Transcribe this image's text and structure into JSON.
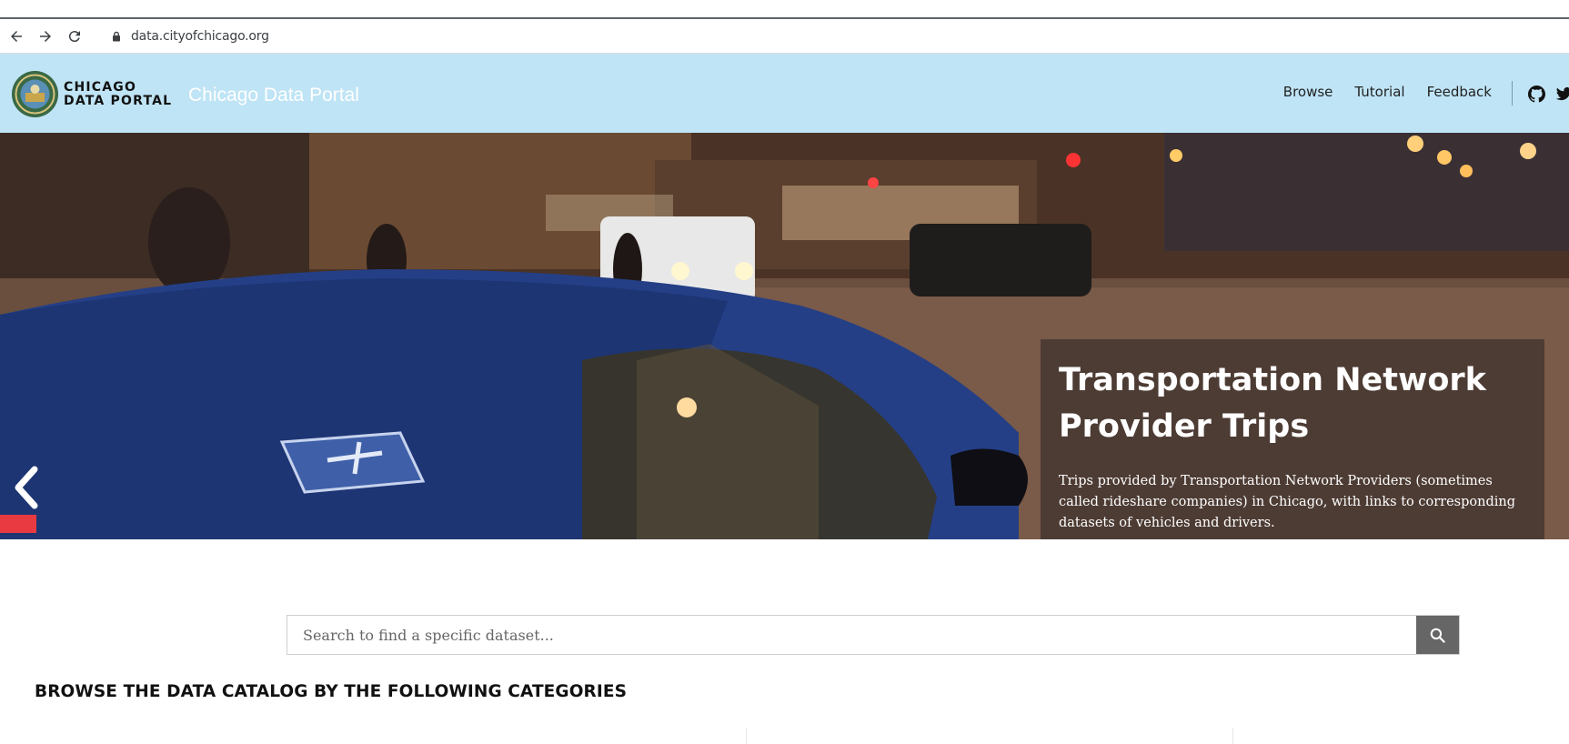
{
  "browser": {
    "url": "data.cityofchicago.org",
    "back_icon": "arrow-left-icon",
    "forward_icon": "arrow-right-icon",
    "reload_icon": "reload-icon",
    "lock_icon": "lock-icon"
  },
  "header": {
    "logo_line1": "CHICAGO",
    "logo_line2": "DATA PORTAL",
    "site_title": "Chicago Data Portal",
    "nav": [
      {
        "label": "Browse"
      },
      {
        "label": "Tutorial"
      },
      {
        "label": "Feedback"
      }
    ],
    "social": [
      "github-icon",
      "twitter-icon"
    ],
    "background_color": "#bfe4f5"
  },
  "hero": {
    "caption_title": "Transportation Network Provider Trips",
    "caption_text": "Trips provided by Transportation Network Providers (sometimes called rideshare companies) in Chicago, with links to corresponding datasets of vehicles and drivers.",
    "prev_icon": "chevron-left-icon"
  },
  "search": {
    "placeholder": "Search to find a specific dataset...",
    "value": "",
    "button_icon": "search-icon"
  },
  "catalog": {
    "heading": "BROWSE THE DATA CATALOG BY THE FOLLOWING CATEGORIES"
  }
}
